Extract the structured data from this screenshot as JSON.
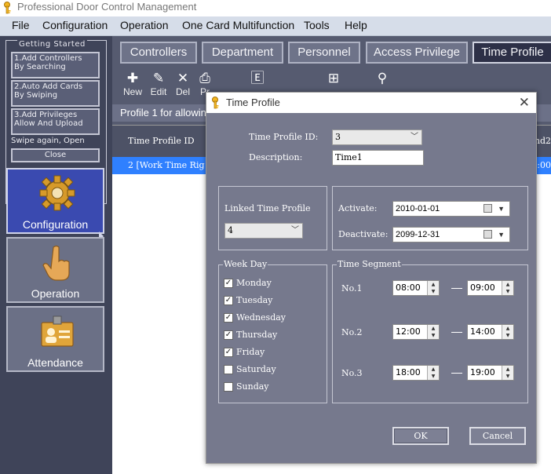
{
  "app": {
    "title": "Professional Door Control Management"
  },
  "menu": [
    "File",
    "Configuration",
    "Operation",
    "One Card Multifunction",
    "Tools",
    "Help"
  ],
  "getting_started": {
    "legend": "Getting Started",
    "step1": [
      "1.Add Controllers",
      "By Searching"
    ],
    "step2": [
      "2.Auto Add Cards",
      "By Swiping"
    ],
    "step3": [
      "3.Add Privileges",
      "Allow And Upload"
    ],
    "swipe_text": "Swipe again, Open",
    "close_label": "Close"
  },
  "nav": {
    "configuration": "Configuration",
    "operation": "Operation",
    "attendance": "Attendance"
  },
  "tabs": [
    "Controllers",
    "Department",
    "Personnel",
    "Access Privilege",
    "Time Profile"
  ],
  "toolbar": {
    "new": "New",
    "edit": "Edit",
    "del": "Del",
    "print": "Pr",
    "export": "Export To Excel",
    "holiday": "Holiday",
    "control": "Control",
    "find": "Find"
  },
  "infobar": "Profile 1 for allowing",
  "grid": {
    "col1": "Time Profile ID",
    "col_tail": "nd2",
    "row1": "2 [Work Time Rig",
    "row1_tail": "0:00"
  },
  "dialog": {
    "title": "Time Profile",
    "id_label": "Time Profile ID:",
    "id_value": "3",
    "desc_label": "Description:",
    "desc_value": "Time1",
    "linked_label": "Linked Time Profile",
    "linked_value": "4",
    "activate_label": "Activate:",
    "activate_value": "2010-01-01",
    "deactivate_label": "Deactivate:",
    "deactivate_value": "2099-12-31",
    "weekday_legend": "Week Day",
    "days": [
      {
        "name": "Monday",
        "checked": true
      },
      {
        "name": "Tuesday",
        "checked": true
      },
      {
        "name": "Wednesday",
        "checked": true
      },
      {
        "name": "Thursday",
        "checked": true
      },
      {
        "name": "Friday",
        "checked": true
      },
      {
        "name": "Saturday",
        "checked": false
      },
      {
        "name": "Sunday",
        "checked": false
      }
    ],
    "segment_legend": "Time Segment",
    "segments": [
      {
        "label": "No.1",
        "from": "08:00",
        "to": "09:00"
      },
      {
        "label": "No.2",
        "from": "12:00",
        "to": "14:00"
      },
      {
        "label": "No.3",
        "from": "18:00",
        "to": "19:00"
      }
    ],
    "ok_label": "OK",
    "cancel_label": "Cancel"
  }
}
